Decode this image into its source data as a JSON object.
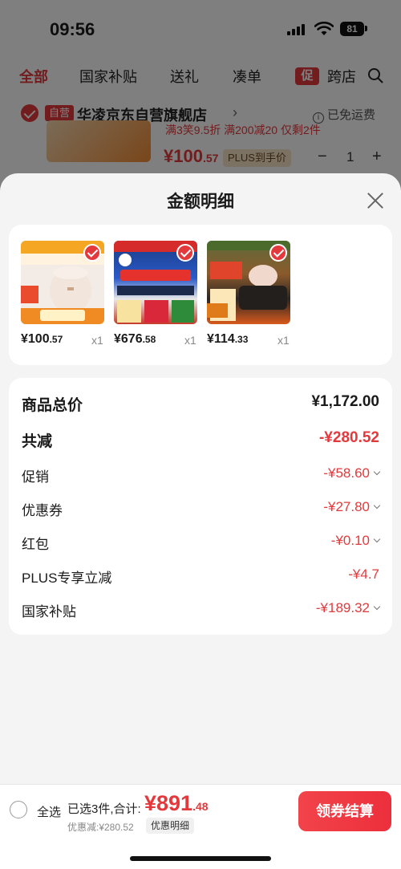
{
  "status_bar": {
    "time": "09:56",
    "battery": "81"
  },
  "background": {
    "tabs": [
      "全部",
      "国家补贴",
      "送礼",
      "凑单",
      "跨店"
    ],
    "promo_badge": "促",
    "store": {
      "tag": "自营",
      "name": "华凌京东自营旗舰店",
      "arrow": "›",
      "free_shipping": "已免运费"
    },
    "product": {
      "deal_text": "满3笑9.5折  满200减20  仅剩2件",
      "price_main": "¥100",
      "price_decimal": ".57",
      "plus_tag": "PLUS到手价",
      "qty": "1",
      "minus": "−",
      "plus": "+"
    }
  },
  "sheet": {
    "title": "金额明细",
    "products": [
      {
        "price_main": "¥100",
        "price_decimal": ".57",
        "qty": "x1"
      },
      {
        "price_main": "¥676",
        "price_decimal": ".58",
        "qty": "x1"
      },
      {
        "price_main": "¥114",
        "price_decimal": ".33",
        "qty": "x1"
      }
    ],
    "summary": {
      "total_label": "商品总价",
      "total_value": "¥1,172.00",
      "reduced_label": "共减",
      "reduced_value": "-¥280.52",
      "items": [
        {
          "label": "促销",
          "value": "-¥58.60"
        },
        {
          "label": "优惠券",
          "value": "-¥27.80"
        },
        {
          "label": "红包",
          "value": "-¥0.10"
        },
        {
          "label": "PLUS专享立减",
          "value": "-¥4.7"
        },
        {
          "label": "国家补贴",
          "value": "-¥189.32"
        }
      ]
    }
  },
  "bottom_bar": {
    "select_all": "全选",
    "selected_text": "已选3件,合计:",
    "total_main": "¥891",
    "total_decimal": ".48",
    "discount_text": "优惠减:¥280.52",
    "detail_label": "优惠明细",
    "checkout_label": "领券结算"
  },
  "colors": {
    "accent": "#e4393c",
    "sheet_bg": "#f4f4f4",
    "card_bg": "#ffffff"
  }
}
